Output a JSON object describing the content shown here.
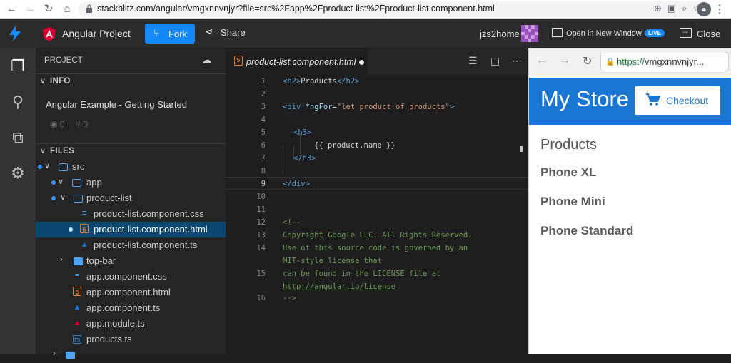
{
  "browser": {
    "url": "stackblitz.com/angular/vmgxnnvnjyr?file=src%2Fapp%2Fproduct-list%2Fproduct-list.component.html",
    "back_icon": "arrow-left",
    "forward_icon": "arrow-right",
    "reload_icon": "reload",
    "home_icon": "home",
    "account_initial": "👤"
  },
  "topbar": {
    "project_name": "Angular Project",
    "fork_label": "Fork",
    "share_label": "Share",
    "username": "jzs2home",
    "open_new_window_label": "Open in New Window",
    "live_badge": "LIVE",
    "close_label": "Close"
  },
  "sidebar": {
    "project_header": "PROJECT",
    "info_header": "INFO",
    "info_title": "Angular Example - Getting Started",
    "stars_count": "0",
    "forks_count": "0",
    "files_header": "FILES",
    "tree": [
      {
        "label": "src",
        "type": "folder-open"
      },
      {
        "label": "app",
        "type": "folder-open"
      },
      {
        "label": "product-list",
        "type": "folder-open"
      },
      {
        "label": "product-list.component.css",
        "type": "css"
      },
      {
        "label": "product-list.component.html",
        "type": "html"
      },
      {
        "label": "product-list.component.ts",
        "type": "ts"
      },
      {
        "label": "top-bar",
        "type": "folder-closed"
      },
      {
        "label": "app.component.css",
        "type": "css"
      },
      {
        "label": "app.component.html",
        "type": "html"
      },
      {
        "label": "app.component.ts",
        "type": "ts"
      },
      {
        "label": "app.module.ts",
        "type": "ng"
      },
      {
        "label": "products.ts",
        "type": "tsfile"
      }
    ]
  },
  "editor": {
    "tab_name": "product-list.component.html",
    "line_numbers": [
      "1",
      "2",
      "3",
      "4",
      "5",
      "6",
      "7",
      "8",
      "9",
      "10",
      "11",
      "12",
      "13",
      "14",
      "15",
      "16"
    ],
    "lines": {
      "l1_open": "<h2>",
      "l1_text": "Products",
      "l1_close": "</h2>",
      "l3_open": "<div ",
      "l3_attr": "*ngFor",
      "l3_eq": "=",
      "l3_str": "\"let product of products\"",
      "l3_end": ">",
      "l5": "<h3>",
      "l6": "{{ product.name }}",
      "l7": "</h3>",
      "l9": "</div>",
      "l12": "<!--",
      "l13": "Copyright Google LLC. All Rights Reserved.",
      "l14a": "Use of this source code is governed by an",
      "l14b": "MIT-style license that",
      "l15a": "can be found in the LICENSE file at",
      "l15b": "http://angular.io/license",
      "l16": "-->"
    }
  },
  "preview": {
    "url_scheme": "https://",
    "url_rest": "vmgxnnvnjyr...",
    "store_title": "My Store",
    "checkout_label": "Checkout",
    "products_heading": "Products",
    "products": [
      "Phone XL",
      "Phone Mini",
      "Phone Standard"
    ]
  },
  "colors": {
    "accent": "#1389fd",
    "store_bar": "#1976d2",
    "selection": "#094771"
  }
}
